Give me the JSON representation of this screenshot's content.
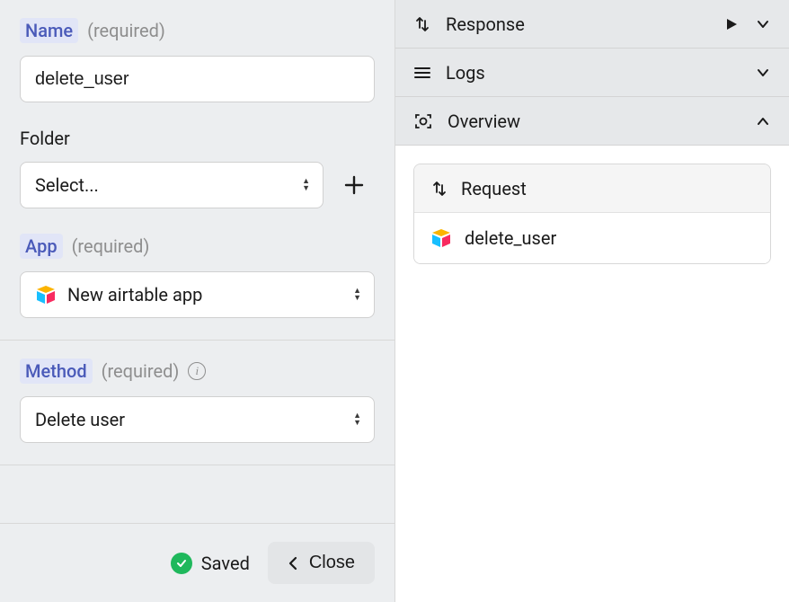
{
  "form": {
    "name": {
      "label": "Name",
      "required": "(required)",
      "value": "delete_user"
    },
    "folder": {
      "label": "Folder",
      "placeholder": "Select..."
    },
    "app": {
      "label": "App",
      "required": "(required)",
      "value": "New airtable app"
    },
    "method": {
      "label": "Method",
      "required": "(required)",
      "value": "Delete user"
    }
  },
  "footer": {
    "saved": "Saved",
    "close": "Close"
  },
  "right": {
    "sections": {
      "response": "Response",
      "logs": "Logs",
      "overview": "Overview"
    },
    "card": {
      "header": "Request",
      "item": "delete_user"
    }
  }
}
